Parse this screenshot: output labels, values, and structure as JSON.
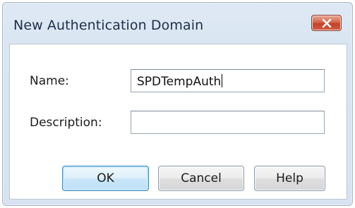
{
  "dialog": {
    "title": "New Authentication Domain",
    "close_icon": "close-x-icon"
  },
  "form": {
    "name_label": "Name:",
    "name_value": "SPDTempAuth",
    "description_label": "Description:",
    "description_value": ""
  },
  "buttons": {
    "ok": "OK",
    "cancel": "Cancel",
    "help": "Help"
  },
  "colors": {
    "close_button": "#d35c40",
    "default_button_border": "#4d8fbf",
    "title_text": "#1e2f45"
  }
}
